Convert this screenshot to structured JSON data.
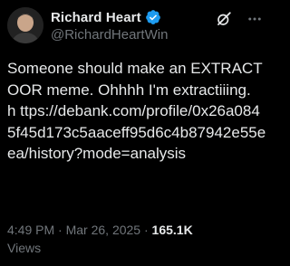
{
  "author": {
    "display_name": "Richard Heart",
    "handle": "@RichardHeartWin",
    "verified_color": "#1d9bf0"
  },
  "icons": {
    "verified": "verified-badge-icon",
    "grok": "grok-icon",
    "more": "more-options-icon"
  },
  "tweet": {
    "text": "Someone should make an EXTRACTOOR meme. Ohhhh I'm extractiiing.   h ttps://debank.com/profile/0x26a0845f45d173c5aaceff95d6c4b87942e55eea/history?mode=analysis"
  },
  "meta": {
    "time": "4:49 PM",
    "separator": " · ",
    "date": "Mar 26, 2025",
    "separator2": " · ",
    "views_count": "165.1K",
    "views_label": "Views"
  }
}
